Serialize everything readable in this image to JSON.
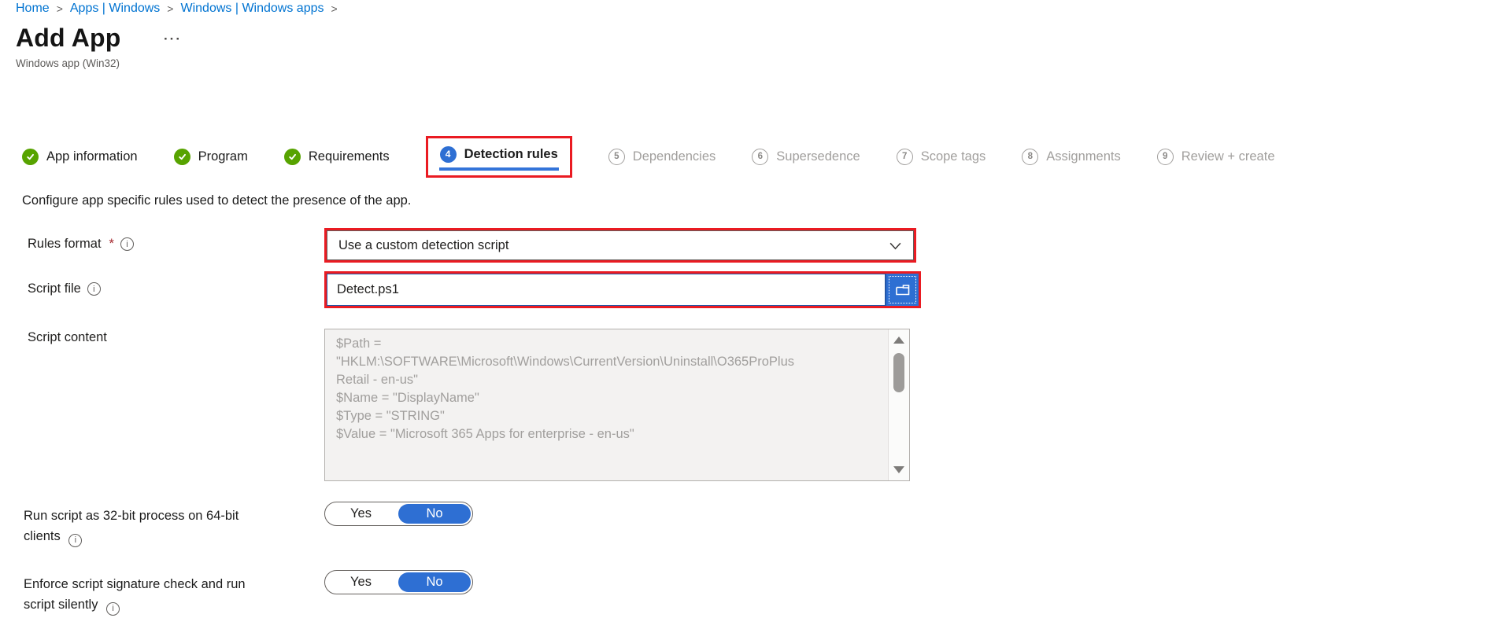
{
  "breadcrumb": {
    "separator": ">",
    "items": [
      {
        "label": "Home"
      },
      {
        "label": "Apps | Windows"
      },
      {
        "label": "Windows | Windows apps"
      }
    ]
  },
  "header": {
    "title": "Add App",
    "more_ellipsis": "···",
    "subtitle": "Windows app (Win32)"
  },
  "wizard": {
    "steps": [
      {
        "label": "App information",
        "state": "done"
      },
      {
        "label": "Program",
        "state": "done"
      },
      {
        "label": "Requirements",
        "state": "done"
      },
      {
        "label": "Detection rules",
        "state": "active",
        "number": "4"
      },
      {
        "label": "Dependencies",
        "state": "future",
        "number": "5"
      },
      {
        "label": "Supersedence",
        "state": "future",
        "number": "6"
      },
      {
        "label": "Scope tags",
        "state": "future",
        "number": "7"
      },
      {
        "label": "Assignments",
        "state": "future",
        "number": "8"
      },
      {
        "label": "Review + create",
        "state": "future",
        "number": "9"
      }
    ]
  },
  "description": "Configure app specific rules used to detect the presence of the app.",
  "form": {
    "rules_format": {
      "label": "Rules format",
      "required_marker": "*",
      "value": "Use a custom detection script"
    },
    "script_file": {
      "label": "Script file",
      "value": "Detect.ps1"
    },
    "script_content": {
      "label": "Script content",
      "lines": [
        "$Path =",
        "\"HKLM:\\SOFTWARE\\Microsoft\\Windows\\CurrentVersion\\Uninstall\\O365ProPlus",
        "Retail - en-us\"",
        "$Name = \"DisplayName\"",
        "$Type = \"STRING\"",
        "$Value = \"Microsoft 365 Apps for enterprise - en-us\""
      ]
    },
    "run_32bit": {
      "label_line1": "Run script as 32-bit process on 64-bit",
      "label_line2": "clients",
      "yes_label": "Yes",
      "no_label": "No",
      "selected": "No"
    },
    "enforce_signature": {
      "label_line1": "Enforce script signature check and run",
      "label_line2": "script silently",
      "yes_label": "Yes",
      "no_label": "No",
      "selected": "No"
    }
  },
  "icons": {
    "done_step": "check-icon",
    "dropdown": "chevron-down-icon",
    "browse": "folder-icon",
    "info": "info-icon",
    "scroll_up": "triangle-up-icon",
    "scroll_down": "triangle-down-icon"
  },
  "colors": {
    "accent_blue": "#2e6fd3",
    "success_green": "#57a300",
    "annotation_red": "#ea1b22",
    "link_blue": "#0073d1",
    "disabled_gray": "#a19f9d"
  }
}
